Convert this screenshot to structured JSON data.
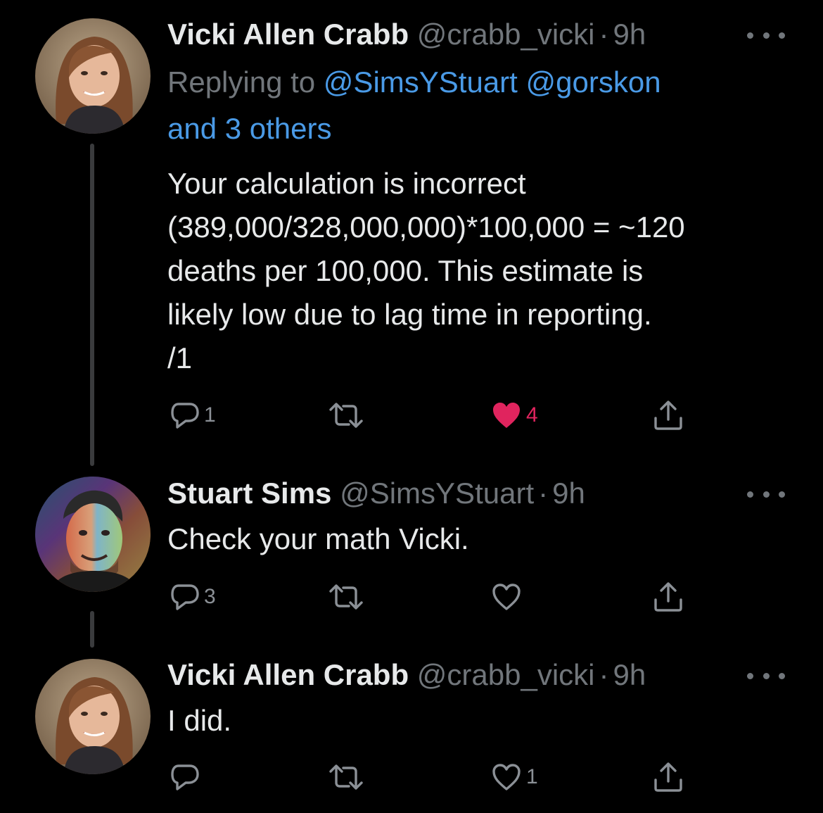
{
  "tweets": [
    {
      "name": "Vicki Allen Crabb",
      "handle": "@crabb_vicki",
      "time_separator": "·",
      "time": "9h",
      "replying_prefix": "Replying to ",
      "replying_mentions": "@SimsYStuart @gorskon",
      "replying_others": "and 3 others",
      "text": "Your calculation is incorrect\n(389,000/328,000,000)*100,000 = ~120\ndeaths per 100,000. This estimate is\nlikely low due to lag time in reporting.\n/1",
      "reply_count": "1",
      "retweet_count": "",
      "like_count": "4",
      "liked": true,
      "avatar_icon": "woman-portrait-avatar"
    },
    {
      "name": "Stuart Sims",
      "handle": "@SimsYStuart",
      "time_separator": "·",
      "time": "9h",
      "text": "Check your math Vicki.",
      "reply_count": "3",
      "retweet_count": "",
      "like_count": "",
      "liked": false,
      "avatar_icon": "man-rainbow-portrait-avatar"
    },
    {
      "name": "Vicki Allen Crabb",
      "handle": "@crabb_vicki",
      "time_separator": "·",
      "time": "9h",
      "text": "I did.",
      "reply_count": "",
      "retweet_count": "",
      "like_count": "1",
      "liked": false,
      "avatar_icon": "woman-portrait-avatar"
    }
  ],
  "icons": {
    "reply": "reply-bubble-icon",
    "retweet": "retweet-icon",
    "like": "heart-icon",
    "share": "share-icon",
    "more": "more-options-icon"
  },
  "colors": {
    "background": "#000000",
    "text": "#e7e9ea",
    "secondary": "#71767b",
    "link": "#4a9ae6",
    "like": "#e0245e",
    "thread_line": "#3a3b3d"
  }
}
